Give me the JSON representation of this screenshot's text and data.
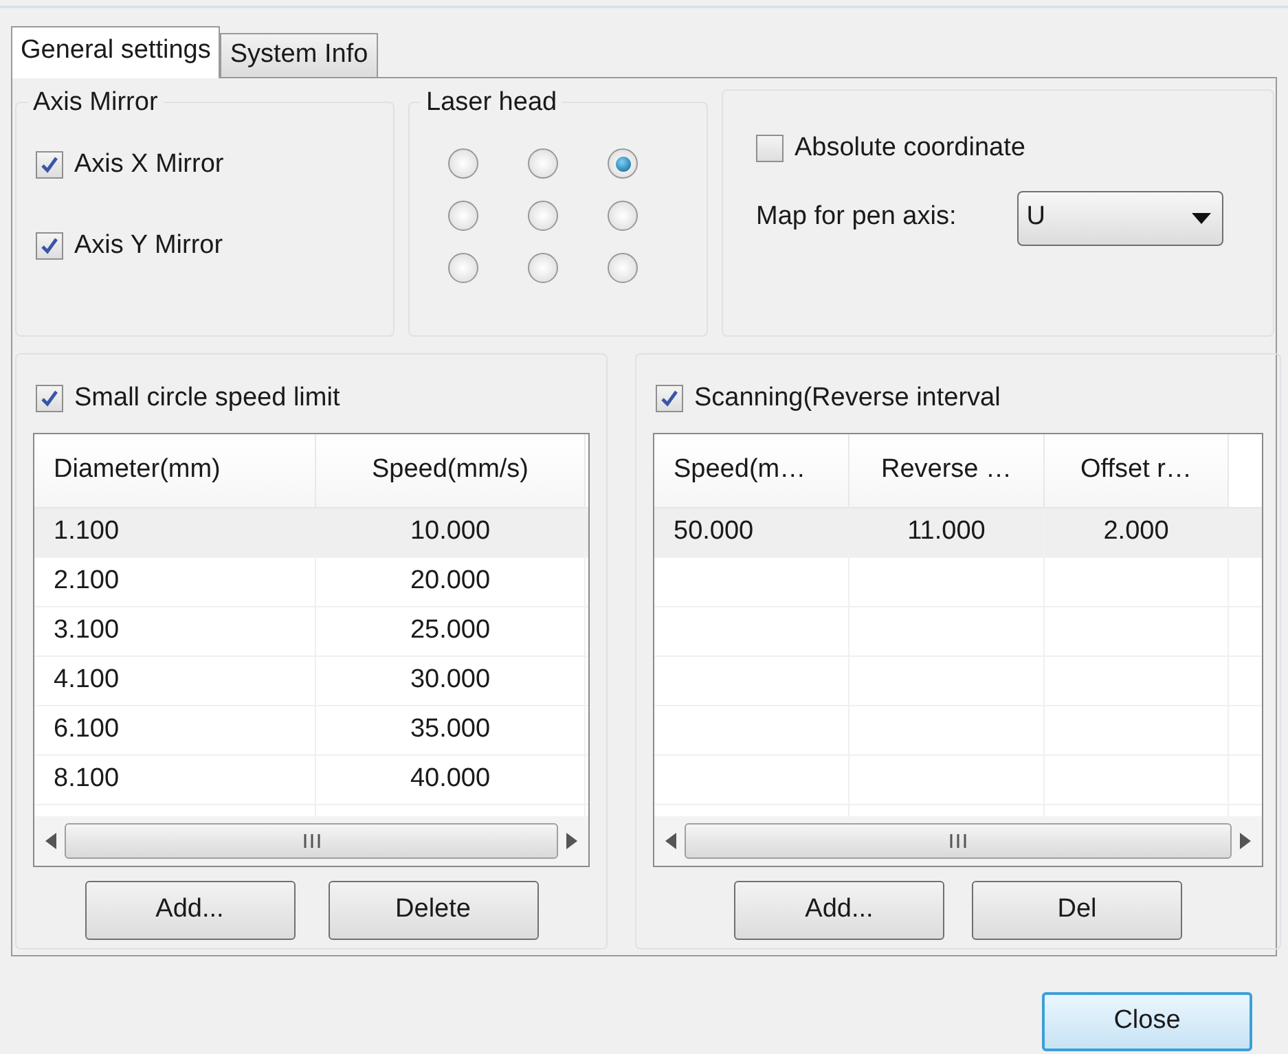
{
  "tabs": [
    {
      "label": "General settings",
      "selected": true
    },
    {
      "label": "System Info",
      "selected": false
    }
  ],
  "axis_mirror": {
    "title": "Axis Mirror",
    "options": [
      {
        "label": "Axis X Mirror",
        "checked": true
      },
      {
        "label": "Axis Y Mirror",
        "checked": true
      }
    ]
  },
  "laser_head": {
    "title": "Laser head",
    "positions": [
      {
        "selected": false
      },
      {
        "selected": false
      },
      {
        "selected": true
      },
      {
        "selected": false
      },
      {
        "selected": false
      },
      {
        "selected": false
      },
      {
        "selected": false
      },
      {
        "selected": false
      },
      {
        "selected": false
      }
    ]
  },
  "coordinates": {
    "absolute": {
      "label": "Absolute coordinate",
      "checked": false
    },
    "pen_axis": {
      "label": "Map for pen axis:",
      "value": "U"
    }
  },
  "panels": [
    {
      "label": "Small circle speed limit",
      "checked": true,
      "columns": [
        "Diameter(mm)",
        "Speed(mm/s)"
      ],
      "rows": [
        {
          "cells": [
            "1.100",
            "10.000"
          ],
          "selected": true
        },
        {
          "cells": [
            "2.100",
            "20.000"
          ],
          "selected": false
        },
        {
          "cells": [
            "3.100",
            "25.000"
          ],
          "selected": false
        },
        {
          "cells": [
            "4.100",
            "30.000"
          ],
          "selected": false
        },
        {
          "cells": [
            "6.100",
            "35.000"
          ],
          "selected": false
        },
        {
          "cells": [
            "8.100",
            "40.000"
          ],
          "selected": false
        }
      ],
      "buttons": [
        "Add...",
        "Delete"
      ]
    },
    {
      "label": "Scanning(Reverse interval",
      "checked": true,
      "columns": [
        "Speed(m…",
        "Reverse …",
        "Offset r…"
      ],
      "rows": [
        {
          "cells": [
            "50.000",
            "11.000",
            "2.000"
          ],
          "selected": true
        }
      ],
      "buttons": [
        "Add...",
        "Del"
      ]
    }
  ],
  "footer": {
    "buttons": [
      {
        "label": "Close",
        "focused": true
      }
    ]
  }
}
